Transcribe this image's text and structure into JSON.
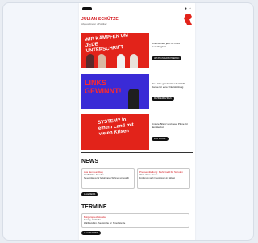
{
  "header": {
    "name": "JULIAN SCHÜTZE",
    "subtitle": "Abgeordneter • Politiker",
    "brand_color": "#d3161c"
  },
  "tiles": [
    {
      "headline": "WIR KÄMPFEN UM JEDE UNTERSCHRIFT",
      "bg": "#e2231a",
      "fg": "#ffffff",
      "side_text": "Unterschreib jetzt für mehr Gerechtigkeit",
      "side_button": "JETZT UNTERSCHREIBEN"
    },
    {
      "headline": "LINKS GEWINNT!",
      "bg": "#3a2bd6",
      "fg": "#ff2a2a",
      "side_text": "Die Linke gewinnt bei der Wahl – Danke für eure Unterstützung",
      "side_button": "MEHR ERFAHREN"
    },
    {
      "headline": "SYSTEM? In einem Land mit vielen Krisen",
      "bg": "#e2231a",
      "fg": "#ffffff",
      "side_text": "Unsere Bilanz und neue Pläne für den Herbst",
      "side_button": "ZUR BILANZ"
    }
  ],
  "news": {
    "title": "NEWS",
    "items": [
      {
        "title": "Aus dem Landtag",
        "meta": "12.05.2024 • Aktuelles",
        "text": "Neue Initiative für bezahlbares Wohnen vorgestellt"
      },
      {
        "title": "Pressemitteilung: Mehr Geld für Schulen",
        "meta": "08.05.2024 • Presse",
        "text": "Forderung nach Investitionen in Bildung"
      }
    ],
    "button": "ALLE NEWS"
  },
  "termine": {
    "title": "TERMINE",
    "items": [
      {
        "title": "Bürgersprechstunde",
        "meta": "Montag, 17:00 Uhr",
        "text": "Wahlkreisbüro, Hauptstraße 12, Sprechstunde"
      }
    ],
    "button": "ALLE TERMINE"
  }
}
